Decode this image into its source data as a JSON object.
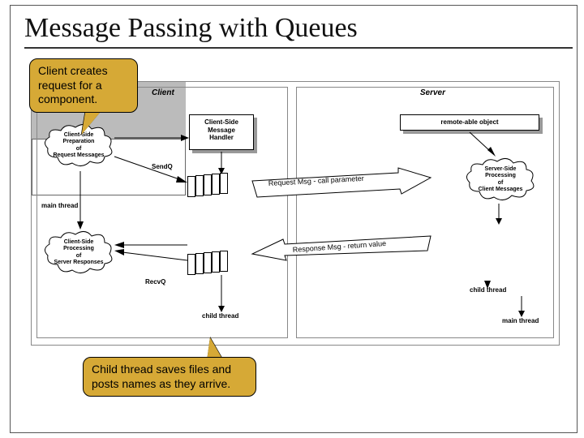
{
  "title": "Message Passing with Queues",
  "callouts": {
    "top": "Client creates request for a component.",
    "bottom": "Child thread saves files and posts names as they arrive."
  },
  "labels": {
    "client": "Client",
    "server": "Server",
    "sendq": "SendQ",
    "recvq": "RecvQ",
    "main_thread": "main thread",
    "child_thread": "child thread"
  },
  "clouds": {
    "client_prep": "Client-Side\nPreparation\nof\nRequest Messages",
    "client_proc": "Client-Side\nProcessing\nof\nServer Responses",
    "server_proc": "Server-Side\nProcessing\nof\nClient Messages"
  },
  "boxes": {
    "handler": "Client-Side\nMessage\nHandler",
    "remote": "remote-able object"
  },
  "messages": {
    "request": "Request Msg - call parameter",
    "response": "Response Msg - return value"
  }
}
